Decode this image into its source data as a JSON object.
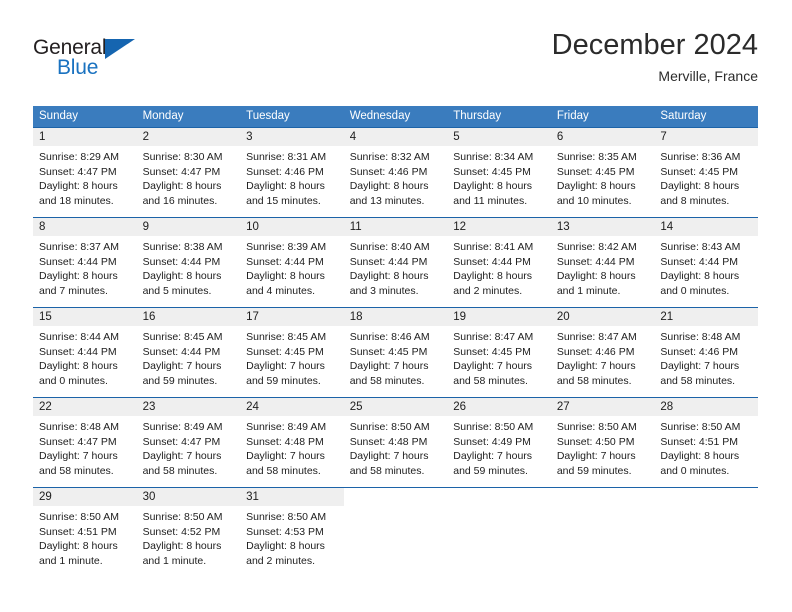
{
  "brand": {
    "name_part1": "General",
    "name_part2": "Blue",
    "triangle_color": "#1565b0"
  },
  "header": {
    "month_title": "December 2024",
    "location": "Merville, France",
    "header_bg_color": "#3a7cbe",
    "row_border_color": "#1c63a8",
    "daynum_bg_color": "#efefef"
  },
  "weekday_headers": [
    "Sunday",
    "Monday",
    "Tuesday",
    "Wednesday",
    "Thursday",
    "Friday",
    "Saturday"
  ],
  "weeks": [
    [
      {
        "day": "1",
        "sunrise": "Sunrise: 8:29 AM",
        "sunset": "Sunset: 4:47 PM",
        "daylight_line1": "Daylight: 8 hours",
        "daylight_line2": "and 18 minutes."
      },
      {
        "day": "2",
        "sunrise": "Sunrise: 8:30 AM",
        "sunset": "Sunset: 4:47 PM",
        "daylight_line1": "Daylight: 8 hours",
        "daylight_line2": "and 16 minutes."
      },
      {
        "day": "3",
        "sunrise": "Sunrise: 8:31 AM",
        "sunset": "Sunset: 4:46 PM",
        "daylight_line1": "Daylight: 8 hours",
        "daylight_line2": "and 15 minutes."
      },
      {
        "day": "4",
        "sunrise": "Sunrise: 8:32 AM",
        "sunset": "Sunset: 4:46 PM",
        "daylight_line1": "Daylight: 8 hours",
        "daylight_line2": "and 13 minutes."
      },
      {
        "day": "5",
        "sunrise": "Sunrise: 8:34 AM",
        "sunset": "Sunset: 4:45 PM",
        "daylight_line1": "Daylight: 8 hours",
        "daylight_line2": "and 11 minutes."
      },
      {
        "day": "6",
        "sunrise": "Sunrise: 8:35 AM",
        "sunset": "Sunset: 4:45 PM",
        "daylight_line1": "Daylight: 8 hours",
        "daylight_line2": "and 10 minutes."
      },
      {
        "day": "7",
        "sunrise": "Sunrise: 8:36 AM",
        "sunset": "Sunset: 4:45 PM",
        "daylight_line1": "Daylight: 8 hours",
        "daylight_line2": "and 8 minutes."
      }
    ],
    [
      {
        "day": "8",
        "sunrise": "Sunrise: 8:37 AM",
        "sunset": "Sunset: 4:44 PM",
        "daylight_line1": "Daylight: 8 hours",
        "daylight_line2": "and 7 minutes."
      },
      {
        "day": "9",
        "sunrise": "Sunrise: 8:38 AM",
        "sunset": "Sunset: 4:44 PM",
        "daylight_line1": "Daylight: 8 hours",
        "daylight_line2": "and 5 minutes."
      },
      {
        "day": "10",
        "sunrise": "Sunrise: 8:39 AM",
        "sunset": "Sunset: 4:44 PM",
        "daylight_line1": "Daylight: 8 hours",
        "daylight_line2": "and 4 minutes."
      },
      {
        "day": "11",
        "sunrise": "Sunrise: 8:40 AM",
        "sunset": "Sunset: 4:44 PM",
        "daylight_line1": "Daylight: 8 hours",
        "daylight_line2": "and 3 minutes."
      },
      {
        "day": "12",
        "sunrise": "Sunrise: 8:41 AM",
        "sunset": "Sunset: 4:44 PM",
        "daylight_line1": "Daylight: 8 hours",
        "daylight_line2": "and 2 minutes."
      },
      {
        "day": "13",
        "sunrise": "Sunrise: 8:42 AM",
        "sunset": "Sunset: 4:44 PM",
        "daylight_line1": "Daylight: 8 hours",
        "daylight_line2": "and 1 minute."
      },
      {
        "day": "14",
        "sunrise": "Sunrise: 8:43 AM",
        "sunset": "Sunset: 4:44 PM",
        "daylight_line1": "Daylight: 8 hours",
        "daylight_line2": "and 0 minutes."
      }
    ],
    [
      {
        "day": "15",
        "sunrise": "Sunrise: 8:44 AM",
        "sunset": "Sunset: 4:44 PM",
        "daylight_line1": "Daylight: 8 hours",
        "daylight_line2": "and 0 minutes."
      },
      {
        "day": "16",
        "sunrise": "Sunrise: 8:45 AM",
        "sunset": "Sunset: 4:44 PM",
        "daylight_line1": "Daylight: 7 hours",
        "daylight_line2": "and 59 minutes."
      },
      {
        "day": "17",
        "sunrise": "Sunrise: 8:45 AM",
        "sunset": "Sunset: 4:45 PM",
        "daylight_line1": "Daylight: 7 hours",
        "daylight_line2": "and 59 minutes."
      },
      {
        "day": "18",
        "sunrise": "Sunrise: 8:46 AM",
        "sunset": "Sunset: 4:45 PM",
        "daylight_line1": "Daylight: 7 hours",
        "daylight_line2": "and 58 minutes."
      },
      {
        "day": "19",
        "sunrise": "Sunrise: 8:47 AM",
        "sunset": "Sunset: 4:45 PM",
        "daylight_line1": "Daylight: 7 hours",
        "daylight_line2": "and 58 minutes."
      },
      {
        "day": "20",
        "sunrise": "Sunrise: 8:47 AM",
        "sunset": "Sunset: 4:46 PM",
        "daylight_line1": "Daylight: 7 hours",
        "daylight_line2": "and 58 minutes."
      },
      {
        "day": "21",
        "sunrise": "Sunrise: 8:48 AM",
        "sunset": "Sunset: 4:46 PM",
        "daylight_line1": "Daylight: 7 hours",
        "daylight_line2": "and 58 minutes."
      }
    ],
    [
      {
        "day": "22",
        "sunrise": "Sunrise: 8:48 AM",
        "sunset": "Sunset: 4:47 PM",
        "daylight_line1": "Daylight: 7 hours",
        "daylight_line2": "and 58 minutes."
      },
      {
        "day": "23",
        "sunrise": "Sunrise: 8:49 AM",
        "sunset": "Sunset: 4:47 PM",
        "daylight_line1": "Daylight: 7 hours",
        "daylight_line2": "and 58 minutes."
      },
      {
        "day": "24",
        "sunrise": "Sunrise: 8:49 AM",
        "sunset": "Sunset: 4:48 PM",
        "daylight_line1": "Daylight: 7 hours",
        "daylight_line2": "and 58 minutes."
      },
      {
        "day": "25",
        "sunrise": "Sunrise: 8:50 AM",
        "sunset": "Sunset: 4:48 PM",
        "daylight_line1": "Daylight: 7 hours",
        "daylight_line2": "and 58 minutes."
      },
      {
        "day": "26",
        "sunrise": "Sunrise: 8:50 AM",
        "sunset": "Sunset: 4:49 PM",
        "daylight_line1": "Daylight: 7 hours",
        "daylight_line2": "and 59 minutes."
      },
      {
        "day": "27",
        "sunrise": "Sunrise: 8:50 AM",
        "sunset": "Sunset: 4:50 PM",
        "daylight_line1": "Daylight: 7 hours",
        "daylight_line2": "and 59 minutes."
      },
      {
        "day": "28",
        "sunrise": "Sunrise: 8:50 AM",
        "sunset": "Sunset: 4:51 PM",
        "daylight_line1": "Daylight: 8 hours",
        "daylight_line2": "and 0 minutes."
      }
    ],
    [
      {
        "day": "29",
        "sunrise": "Sunrise: 8:50 AM",
        "sunset": "Sunset: 4:51 PM",
        "daylight_line1": "Daylight: 8 hours",
        "daylight_line2": "and 1 minute."
      },
      {
        "day": "30",
        "sunrise": "Sunrise: 8:50 AM",
        "sunset": "Sunset: 4:52 PM",
        "daylight_line1": "Daylight: 8 hours",
        "daylight_line2": "and 1 minute."
      },
      {
        "day": "31",
        "sunrise": "Sunrise: 8:50 AM",
        "sunset": "Sunset: 4:53 PM",
        "daylight_line1": "Daylight: 8 hours",
        "daylight_line2": "and 2 minutes."
      },
      {
        "day": "",
        "sunrise": "",
        "sunset": "",
        "daylight_line1": "",
        "daylight_line2": ""
      },
      {
        "day": "",
        "sunrise": "",
        "sunset": "",
        "daylight_line1": "",
        "daylight_line2": ""
      },
      {
        "day": "",
        "sunrise": "",
        "sunset": "",
        "daylight_line1": "",
        "daylight_line2": ""
      },
      {
        "day": "",
        "sunrise": "",
        "sunset": "",
        "daylight_line1": "",
        "daylight_line2": ""
      }
    ]
  ]
}
